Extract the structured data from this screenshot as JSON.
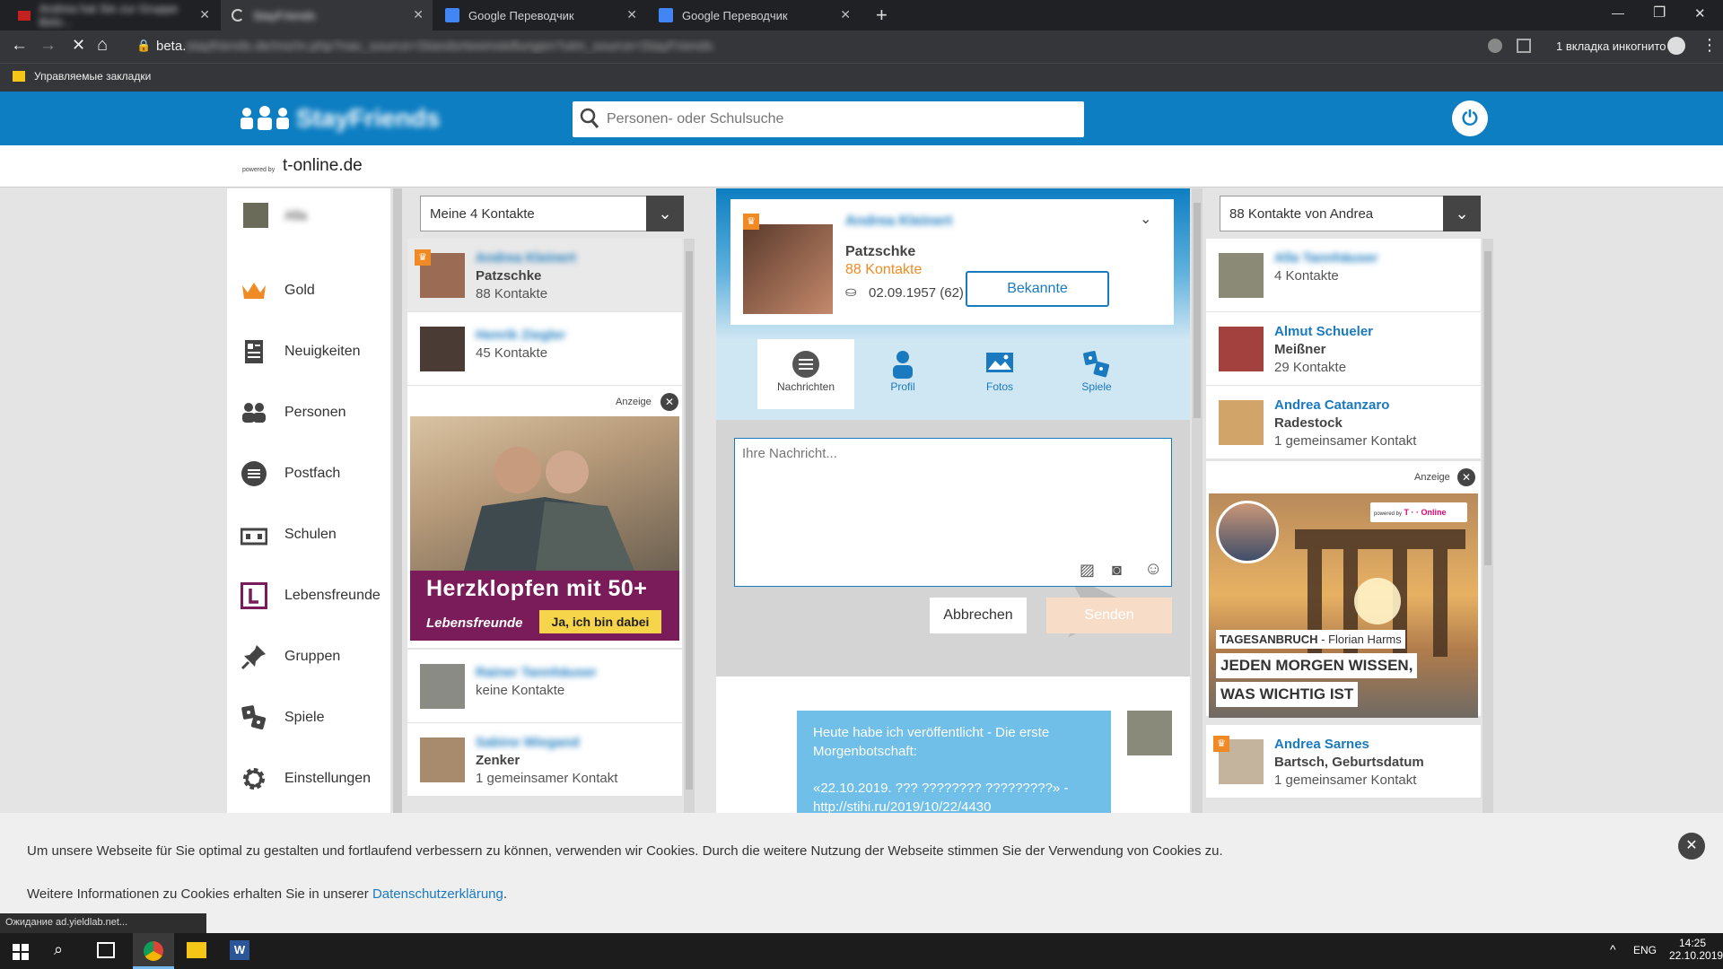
{
  "browser": {
    "tabs": [
      {
        "title": "Andrea hat Sie zur Gruppe Belo...",
        "blurred": true
      },
      {
        "title": "StayFriends",
        "blurred": true
      },
      {
        "title": "Google Переводчик",
        "blurred": false
      },
      {
        "title": "Google Переводчик",
        "blurred": false
      }
    ],
    "new_tab": "+",
    "url_prefix": "beta.",
    "url_rest": "stayfriends.de/ms/m.php?nav_source=Standorteeinstellungen?utm_source=StayFriends",
    "incognito": "1 вкладка инкогнито",
    "bookmarks_label": "Управляемые закладки",
    "status_text": "Ожидание ad.yieldlab.net..."
  },
  "site": {
    "logo_text": "StayFriends",
    "search_placeholder": "Personen- oder Schulsuche",
    "powered_small": "powered by",
    "powered_brand": "t-online.de"
  },
  "nav": {
    "user_name": "Alla",
    "items": [
      "Gold",
      "Neuigkeiten",
      "Personen",
      "Postfach",
      "Schulen",
      "Lebensfreunde",
      "Gruppen",
      "Spiele",
      "Einstellungen"
    ]
  },
  "contacts": {
    "select": "Meine 4 Kontakte",
    "items": [
      {
        "name": "Andrea Kleinert",
        "sub": "Patzschke",
        "count": "88 Kontakte"
      },
      {
        "name": "Henrik Ziegler",
        "sub": "",
        "count": "45 Kontakte"
      },
      {
        "name": "Rainer Tannhäuser",
        "sub": "",
        "count": "keine Kontakte"
      },
      {
        "name": "Sabine Wiegand",
        "sub": "Zenker",
        "count": "1 gemeinsamer Kontakt"
      }
    ],
    "ad_label": "Anzeige",
    "ad_headline": "Herzklopfen mit 50+",
    "ad_brand": "Lebensfreunde",
    "ad_button": "Ja, ich bin dabei"
  },
  "profile": {
    "name": "Andrea Kleinert",
    "sub": "Patzschke",
    "contacts": "88 Kontakte",
    "birthday": "02.09.1957 (62)",
    "relation_button": "Bekannte",
    "tabs": [
      "Nachrichten",
      "Profil",
      "Fotos",
      "Spiele"
    ],
    "message_placeholder": "Ihre Nachricht...",
    "cancel": "Abbrechen",
    "send": "Senden",
    "message_line1": "Heute habe ich veröffentlicht - Die erste",
    "message_line2": "Morgenbotschaft:",
    "message_line3": "«22.10.2019. ??? ???????? ?????????» -",
    "message_line4": "http://stihi.ru/2019/10/22/4430"
  },
  "right": {
    "select": "88 Kontakte von Andrea",
    "items": [
      {
        "name": "Alla Tannhäuser",
        "sub": "",
        "count": "4 Kontakte",
        "blur": true
      },
      {
        "name": "Almut Schueler",
        "sub": "Meißner",
        "count": "29 Kontakte",
        "blur": false
      },
      {
        "name": "Andrea Catanzaro",
        "sub": "Radestock",
        "count": "1 gemeinsamer Kontakt",
        "blur": false
      },
      {
        "name": "Andrea Sarnes",
        "sub": "Bartsch, Geburtsdatum",
        "count": "1 gemeinsamer Kontakt",
        "blur": false
      }
    ],
    "ad_label": "Anzeige",
    "ad_powered": "powered by",
    "ad_brand": "T · · Online",
    "ad_kicker": "TAGESANBRUCH",
    "ad_author": " - Florian Harms",
    "ad_line1": "JEDEN MORGEN WISSEN,",
    "ad_line2": "WAS WICHTIG IST"
  },
  "cookie": {
    "text": "Um unsere Webseite für Sie optimal zu gestalten und fortlaufend verbessern zu können, verwenden wir Cookies. Durch die weitere Nutzung der Webseite stimmen Sie der Verwendung von Cookies zu.",
    "more": "Weitere Informationen zu Cookies erhalten Sie in unserer ",
    "link": "Datenschutzerklärung",
    "dot": "."
  },
  "taskbar": {
    "lang": "ENG",
    "time": "14:25",
    "date": "22.10.2019"
  },
  "colors": {
    "brand": "#0d7ec2",
    "link": "#1a7abf",
    "orange": "#f08a24",
    "ad_purple": "#7a1b5a"
  }
}
